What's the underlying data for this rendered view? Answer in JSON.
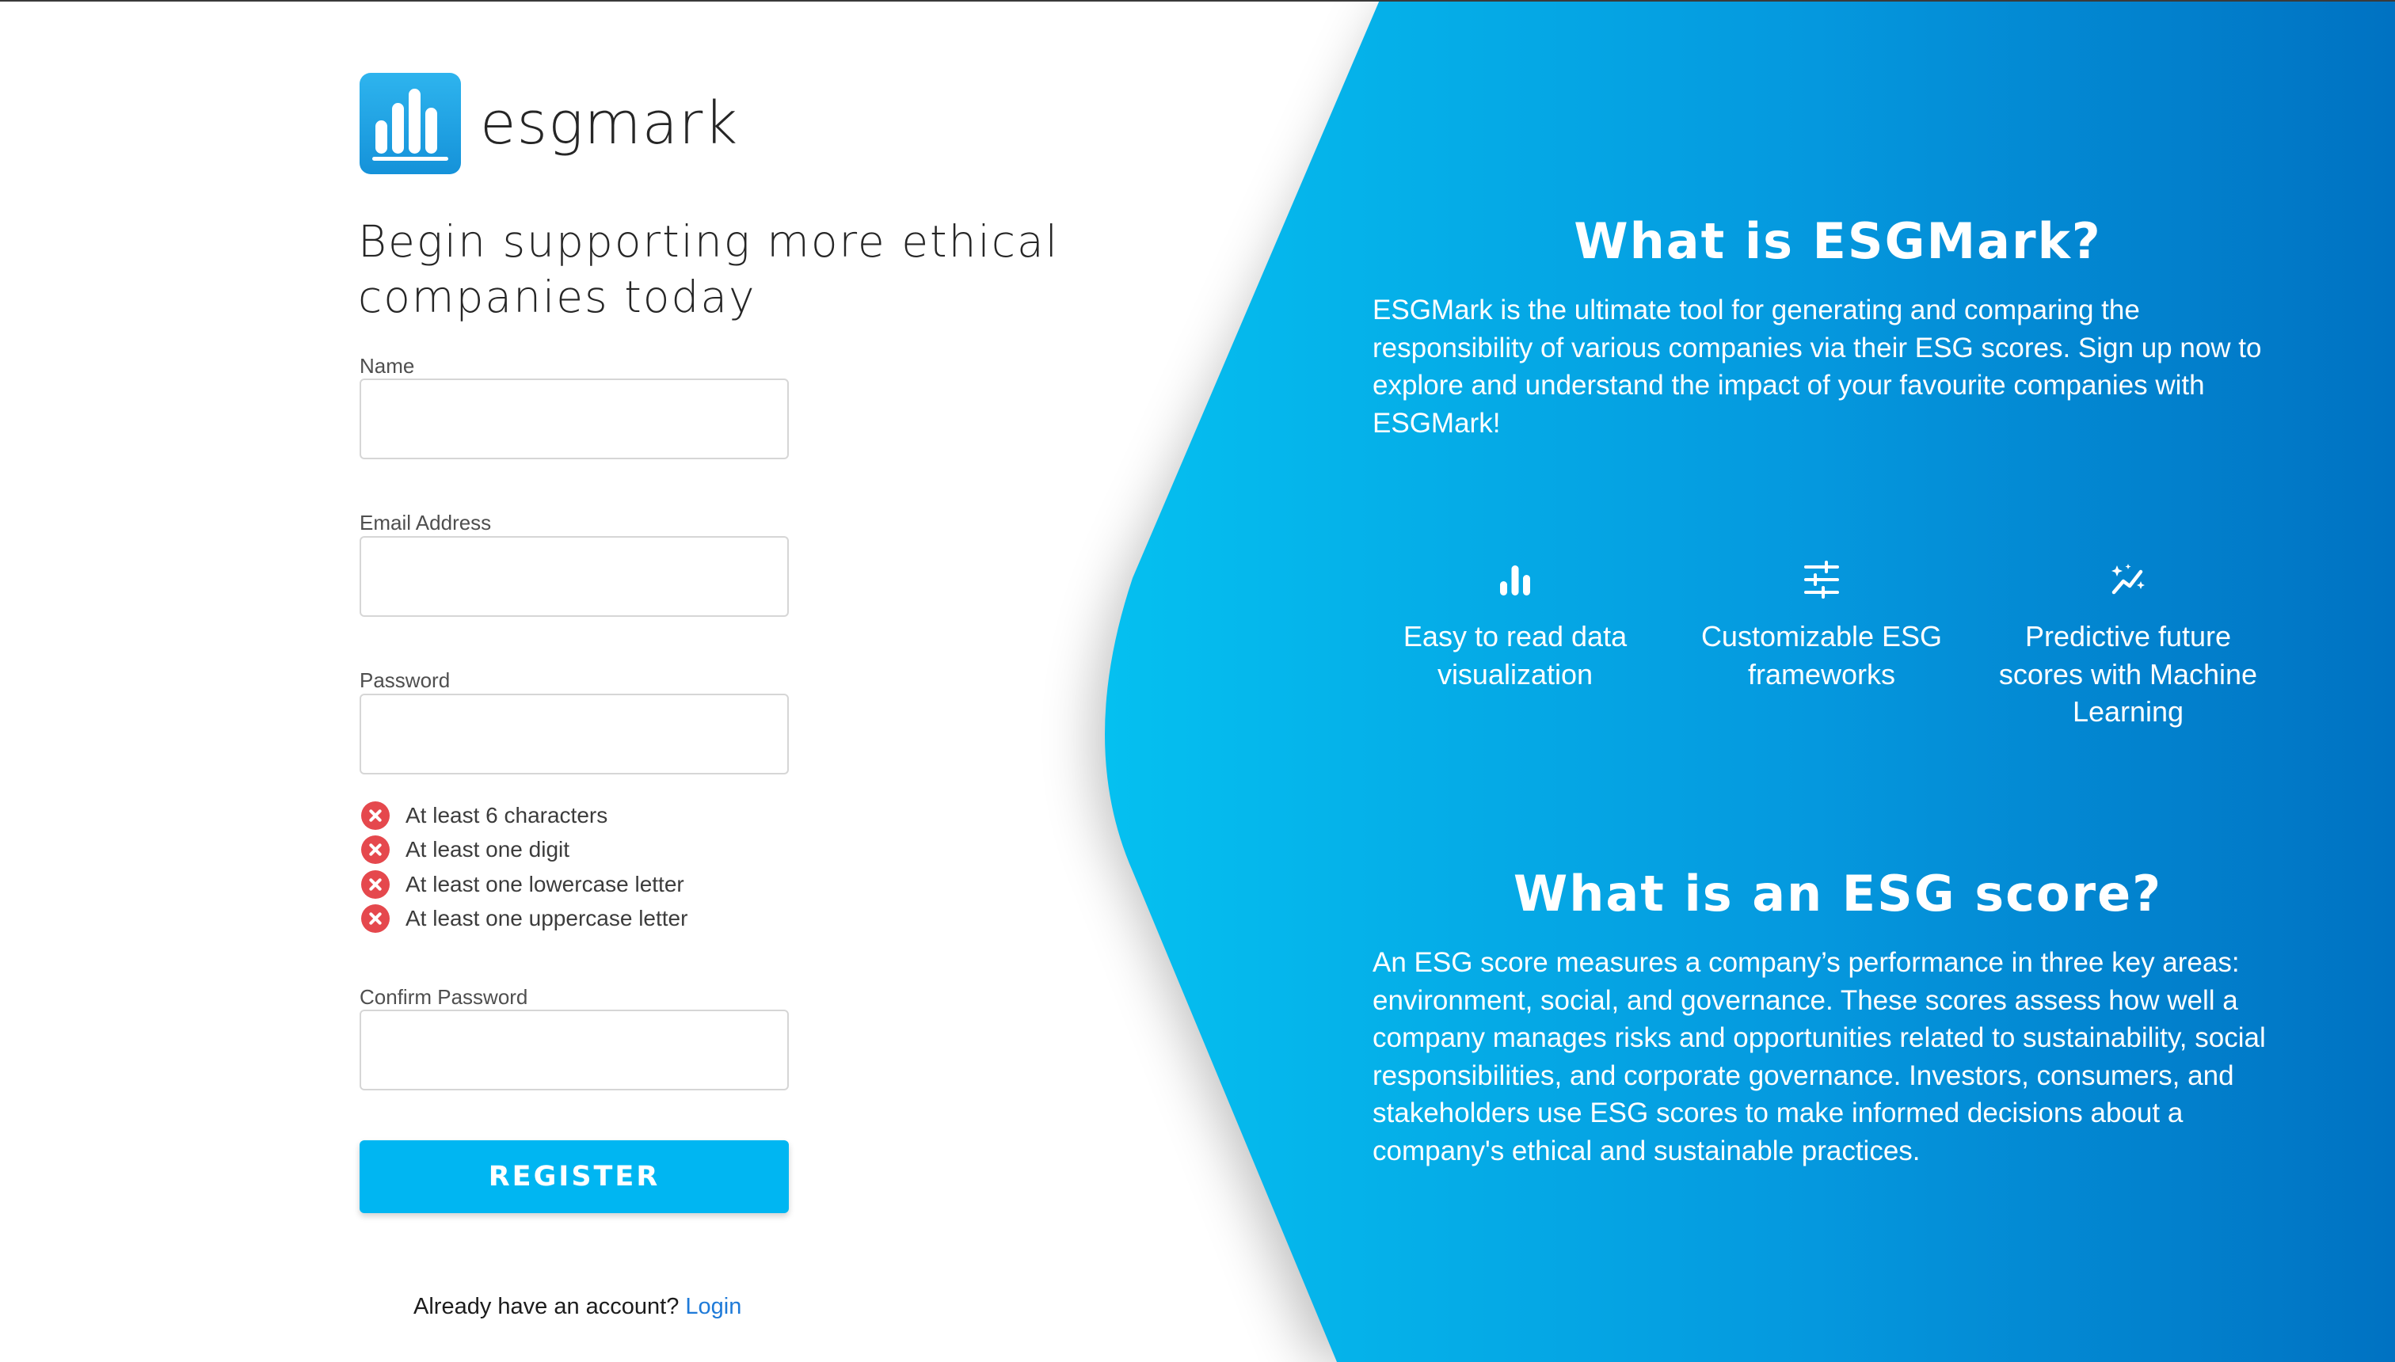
{
  "brand": {
    "name": "esgmark",
    "primary_color": "#00b6f2",
    "panel_gradient": [
      "#05c0f0",
      "#0072c2"
    ]
  },
  "form": {
    "headline": "Begin supporting more ethical companies today",
    "fields": {
      "name": {
        "label": "Name",
        "value": "",
        "placeholder": ""
      },
      "email": {
        "label": "Email Address",
        "value": "",
        "placeholder": ""
      },
      "password": {
        "label": "Password",
        "value": "",
        "placeholder": ""
      },
      "confirm": {
        "label": "Confirm Password",
        "value": "",
        "placeholder": ""
      }
    },
    "password_rules": [
      {
        "text": "At least 6 characters",
        "status": "unmet",
        "icon": "x-circle-icon"
      },
      {
        "text": "At least one digit",
        "status": "unmet",
        "icon": "x-circle-icon"
      },
      {
        "text": "At least one lowercase letter",
        "status": "unmet",
        "icon": "x-circle-icon"
      },
      {
        "text": "At least one uppercase letter",
        "status": "unmet",
        "icon": "x-circle-icon"
      }
    ],
    "register_label": "REGISTER",
    "login_prompt": "Already have an account?",
    "login_link": "Login"
  },
  "info": {
    "about_title": "What is ESGMark?",
    "about_text": "ESGMark is the ultimate tool for generating and comparing the responsibility of various companies via their ESG scores. Sign up now to explore and understand the impact of your favourite companies with ESGMark!",
    "features": [
      {
        "icon": "bar-chart-icon",
        "label": "Easy to read data visualization"
      },
      {
        "icon": "sliders-icon",
        "label": "Customizable ESG frameworks"
      },
      {
        "icon": "sparkle-trend-icon",
        "label": "Predictive future scores with Machine Learning"
      }
    ],
    "score_title": "What is an ESG score?",
    "score_text": "An ESG score measures a company’s performance in three key areas: environment, social, and governance. These scores assess how well a company manages risks and opportunities related to sustainability, social responsibilities, and corporate governance. Investors, consumers, and stakeholders use ESG scores to make informed decisions about a company's ethical and sustainable practices."
  }
}
